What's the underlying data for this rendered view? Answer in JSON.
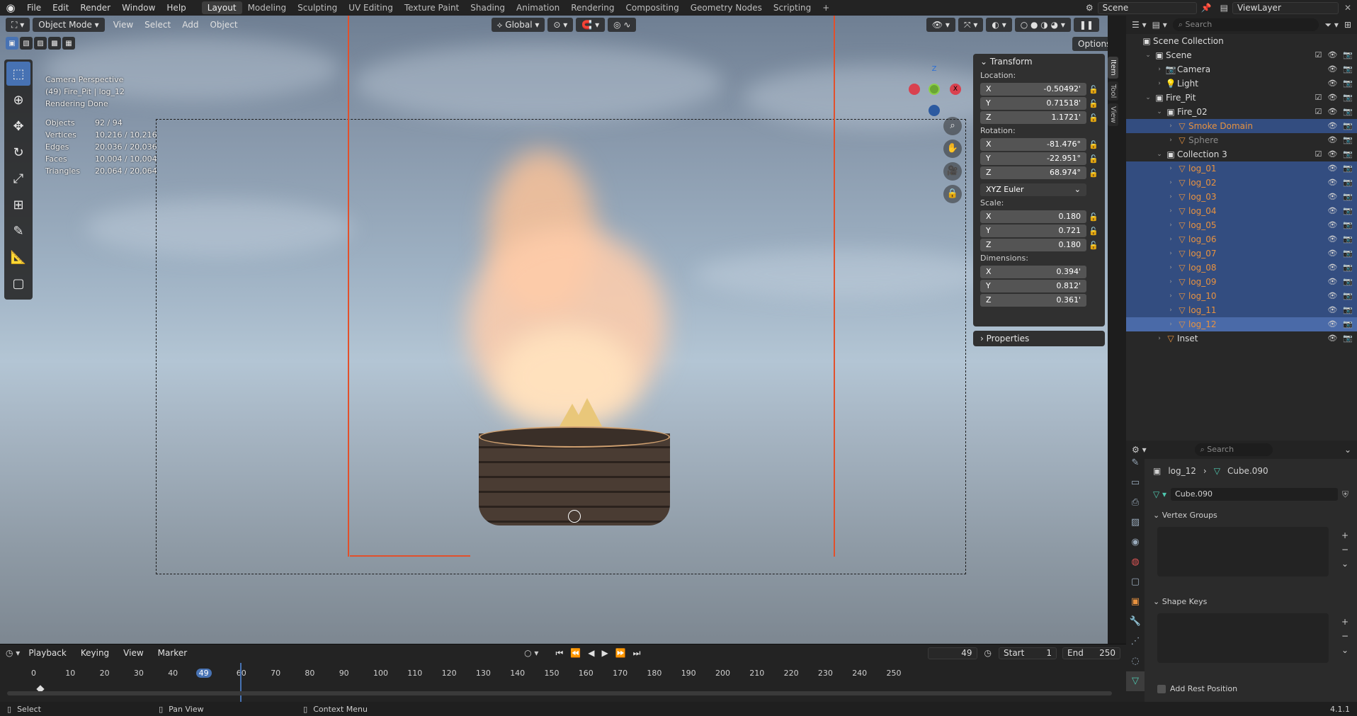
{
  "menus": [
    "File",
    "Edit",
    "Render",
    "Window",
    "Help"
  ],
  "workspaces": [
    "Layout",
    "Modeling",
    "Sculpting",
    "UV Editing",
    "Texture Paint",
    "Shading",
    "Animation",
    "Rendering",
    "Compositing",
    "Geometry Nodes",
    "Scripting"
  ],
  "active_workspace": "Layout",
  "scene_name": "Scene",
  "view_layer": "ViewLayer",
  "viewport_header": {
    "mode": "Object Mode",
    "menus": [
      "View",
      "Select",
      "Add",
      "Object"
    ],
    "orientation": "Global",
    "options": "Options"
  },
  "overlay": {
    "view": "Camera Perspective",
    "object": "(49) Fire_Pit | log_12",
    "status": "Rendering Done",
    "stats": [
      {
        "label": "Objects",
        "value": "92 / 94"
      },
      {
        "label": "Vertices",
        "value": "10,216 / 10,216"
      },
      {
        "label": "Edges",
        "value": "20,036 / 20,036"
      },
      {
        "label": "Faces",
        "value": "10,004 / 10,004"
      },
      {
        "label": "Triangles",
        "value": "20,064 / 20,064"
      }
    ]
  },
  "transform": {
    "title": "Transform",
    "location_label": "Location:",
    "location": {
      "x": "-0.50492'",
      "y": "0.71518'",
      "z": "1.1721'"
    },
    "rotation_label": "Rotation:",
    "rotation": {
      "x": "-81.476°",
      "y": "-22.951°",
      "z": "68.974°"
    },
    "rotation_mode": "XYZ Euler",
    "scale_label": "Scale:",
    "scale": {
      "x": "0.180",
      "y": "0.721",
      "z": "0.180"
    },
    "dimensions_label": "Dimensions:",
    "dimensions": {
      "x": "0.394'",
      "y": "0.812'",
      "z": "0.361'"
    },
    "properties": "Properties"
  },
  "side_tabs": [
    "Item",
    "Tool",
    "View"
  ],
  "outliner": {
    "search_placeholder": "Search",
    "root": "Scene Collection",
    "rows": [
      {
        "name": "Scene",
        "indent": 1,
        "type": "collection",
        "selected": false
      },
      {
        "name": "Camera",
        "indent": 2,
        "type": "camera",
        "selected": false
      },
      {
        "name": "Light",
        "indent": 2,
        "type": "light",
        "selected": false
      },
      {
        "name": "Fire_Pit",
        "indent": 1,
        "type": "collection",
        "selected": false
      },
      {
        "name": "Fire_02",
        "indent": 2,
        "type": "collection",
        "selected": false
      },
      {
        "name": "Smoke Domain",
        "indent": 3,
        "type": "mesh",
        "selected": true
      },
      {
        "name": "Sphere",
        "indent": 3,
        "type": "mesh",
        "selected": false
      },
      {
        "name": "Collection 3",
        "indent": 2,
        "type": "collection",
        "selected": false
      },
      {
        "name": "log_01",
        "indent": 3,
        "type": "mesh",
        "selected": true
      },
      {
        "name": "log_02",
        "indent": 3,
        "type": "mesh",
        "selected": true
      },
      {
        "name": "log_03",
        "indent": 3,
        "type": "mesh",
        "selected": true
      },
      {
        "name": "log_04",
        "indent": 3,
        "type": "mesh",
        "selected": true
      },
      {
        "name": "log_05",
        "indent": 3,
        "type": "mesh",
        "selected": true
      },
      {
        "name": "log_06",
        "indent": 3,
        "type": "mesh",
        "selected": true
      },
      {
        "name": "log_07",
        "indent": 3,
        "type": "mesh",
        "selected": true
      },
      {
        "name": "log_08",
        "indent": 3,
        "type": "mesh",
        "selected": true
      },
      {
        "name": "log_09",
        "indent": 3,
        "type": "mesh",
        "selected": true
      },
      {
        "name": "log_10",
        "indent": 3,
        "type": "mesh",
        "selected": true
      },
      {
        "name": "log_11",
        "indent": 3,
        "type": "mesh",
        "selected": true
      },
      {
        "name": "log_12",
        "indent": 3,
        "type": "mesh",
        "selected": true,
        "active": true
      },
      {
        "name": "Inset",
        "indent": 2,
        "type": "mesh",
        "selected": false
      }
    ]
  },
  "properties": {
    "search_placeholder": "Search",
    "breadcrumb_object": "log_12",
    "breadcrumb_data": "Cube.090",
    "mesh_name": "Cube.090",
    "vertex_groups": "Vertex Groups",
    "shape_keys": "Shape Keys",
    "add_rest_position": "Add Rest Position"
  },
  "timeline": {
    "menus": [
      "Playback",
      "Keying",
      "View",
      "Marker"
    ],
    "current_frame": "49",
    "start_label": "Start",
    "start": "1",
    "end_label": "End",
    "end": "250",
    "ticks": [
      "0",
      "10",
      "20",
      "30",
      "40",
      "49",
      "60",
      "70",
      "80",
      "90",
      "100",
      "110",
      "120",
      "130",
      "140",
      "150",
      "160",
      "170",
      "180",
      "190",
      "200",
      "210",
      "220",
      "230",
      "240",
      "250"
    ]
  },
  "statusbar": {
    "select": "Select",
    "pan": "Pan View",
    "context": "Context Menu",
    "version": "4.1.1"
  },
  "colors": {
    "accent": "#4772b3",
    "selection": "#334d80",
    "orange": "#e8923f",
    "camera_frame": "#e2502b"
  }
}
